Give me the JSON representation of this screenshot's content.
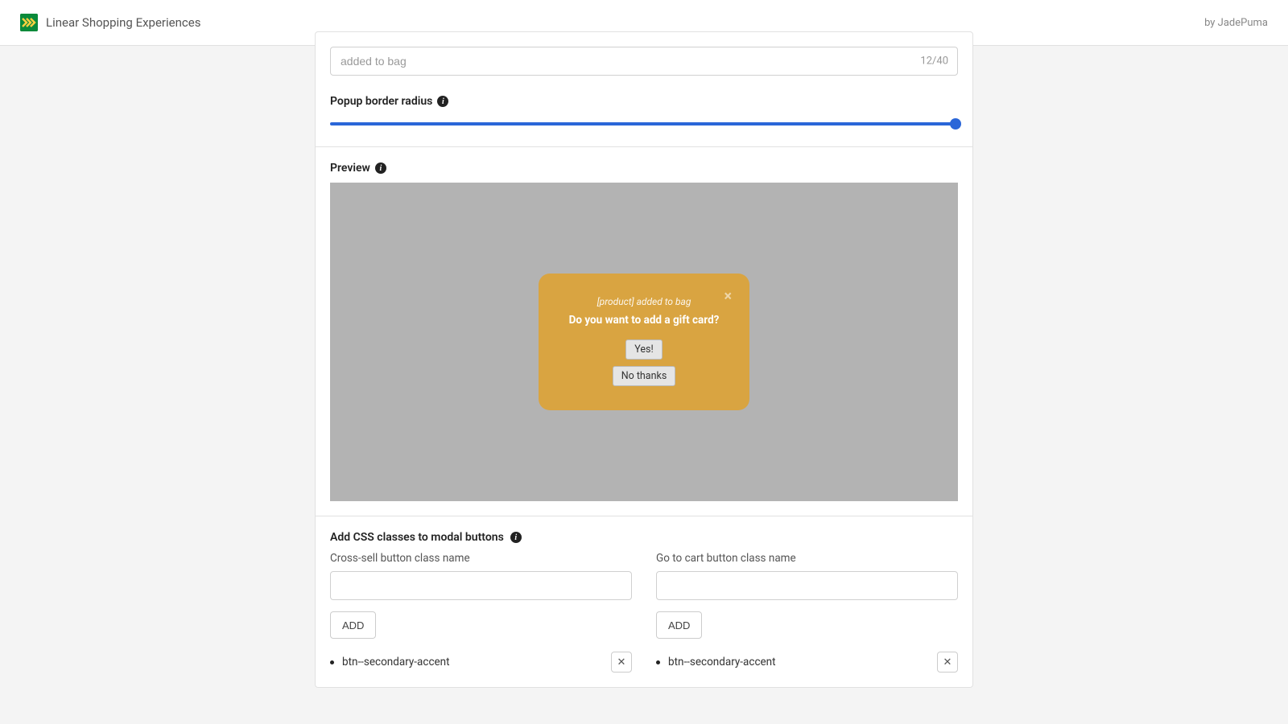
{
  "topbar": {
    "title": "Linear Shopping Experiences",
    "byline": "by JadePuma"
  },
  "input_top": {
    "value": "added to bag",
    "counter": "12/40"
  },
  "border_radius": {
    "label": "Popup border radius"
  },
  "preview": {
    "label": "Preview",
    "popup": {
      "subtext": "[product] added to bag",
      "title": "Do you want to add a gift card?",
      "yes": "Yes!",
      "no": "No thanks",
      "close": "×"
    }
  },
  "css_section": {
    "heading": "Add CSS classes to modal buttons",
    "left": {
      "label": "Cross-sell button class name",
      "add": "ADD",
      "chip": "btn--secondary-accent"
    },
    "right": {
      "label": "Go to cart button class name",
      "add": "ADD",
      "chip": "btn--secondary-accent"
    }
  },
  "icons": {
    "info": "i",
    "close": "✕"
  }
}
